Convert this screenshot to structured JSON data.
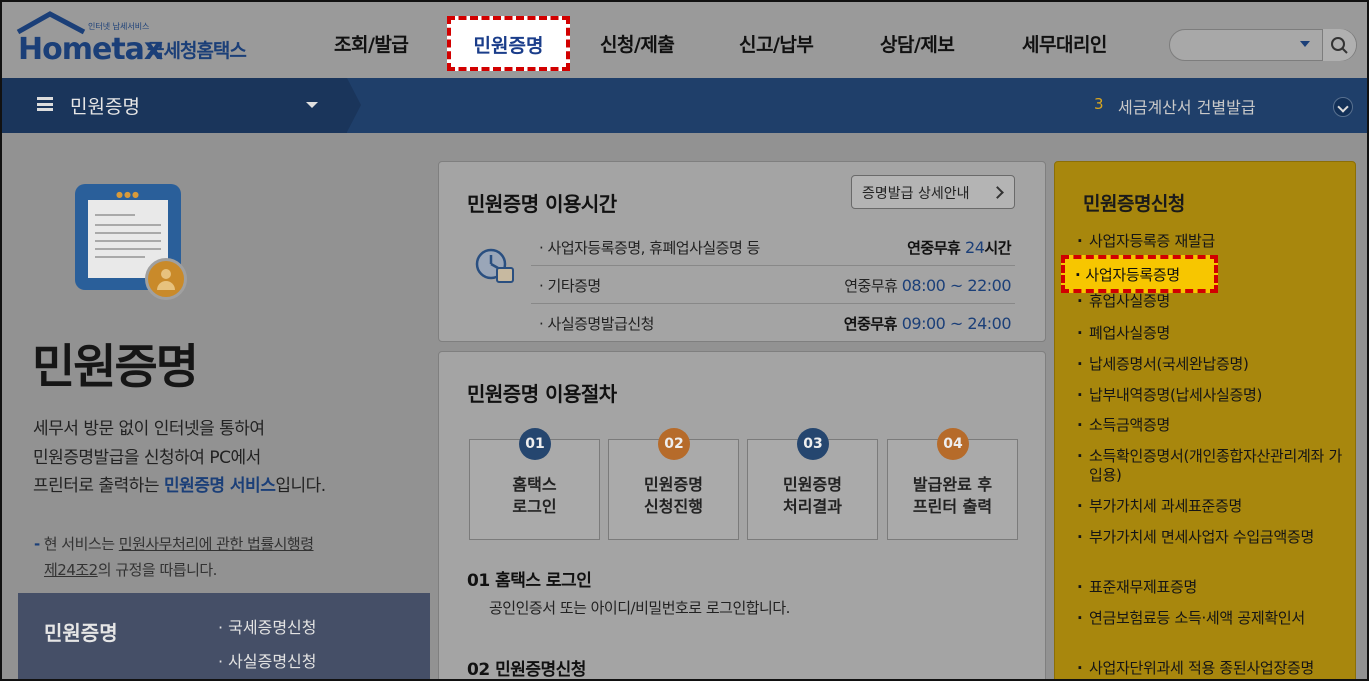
{
  "logo": {
    "brand": "Hometax",
    "subtitle": "국세청홈택스",
    "tagline": "인터넷 납세서비스"
  },
  "nav": {
    "items": [
      "조회/발급",
      "민원증명",
      "신청/제출",
      "신고/납부",
      "상담/제보",
      "세무대리인"
    ],
    "active": "민원증명"
  },
  "search": {
    "placeholder": ""
  },
  "bluebar": {
    "title": "민원증명",
    "ticker_num": "3",
    "ticker_text": "세금계산서 건별발급"
  },
  "hero": {
    "title": "민원증명",
    "desc": [
      "세무서 방문 없이 인터넷을 통하여",
      "민원증명발급을 신청하여 PC에서"
    ],
    "desc3_pre": "프린터로 출력하는 ",
    "desc3_hl": "민원증명 서비스",
    "desc3_post": "입니다.",
    "law1_pre": "현 서비스는 ",
    "law1_link": "민원사무처리에 관한 법률시행령",
    "law2_link": "제24조2",
    "law2_post": "의 규정을 따릅니다."
  },
  "cert_box": {
    "title": "민원증명",
    "links": [
      "· 국세증명신청",
      "· 사실증명신청"
    ]
  },
  "hours": {
    "title": "민원증명 이용시간",
    "guide_button": "증명발급 상세안내",
    "rows": [
      {
        "label": "· 사업자등록증명, 휴폐업사실증명 등",
        "prefix": "연중무휴 ",
        "num": "24",
        "suffix": "시간"
      },
      {
        "label": "· 기타증명",
        "prefix": "연중무휴 ",
        "time": "08:00 ~ 22:00"
      },
      {
        "label": "· 사실증명발급신청",
        "prefix": "연중무휴 ",
        "time": "09:00 ~ 24:00"
      }
    ]
  },
  "procedure": {
    "title": "민원증명 이용절차",
    "steps": [
      {
        "num": "01",
        "text": "홈택스\n로그인",
        "color": "blue"
      },
      {
        "num": "02",
        "text": "민원증명\n신청진행",
        "color": "orange"
      },
      {
        "num": "03",
        "text": "민원증명\n처리결과",
        "color": "blue"
      },
      {
        "num": "04",
        "text": "발급완료 후\n프린터 출력",
        "color": "orange"
      }
    ],
    "sub1_title": "01 홈택스 로그인",
    "sub1_desc": "공인인증서 또는 아이디/비밀번호로 로그인합니다.",
    "sub2_title": "02 민원증명신청"
  },
  "right_panel": {
    "title": "민원증명신청",
    "items": [
      "사업자등록증 재발급",
      "사업자등록증명",
      "휴업사실증명",
      "폐업사실증명",
      "납세증명서(국세완납증명)",
      "납부내역증명(납세사실증명)",
      "소득금액증명",
      "소득확인증명서(개인종합자산관리계좌 가입용)",
      "부가가치세 과세표준증명",
      "부가가치세 면세사업자 수입금액증명",
      "표준재무제표증명",
      "연금보험료등 소득·세액 공제확인서",
      "사업자단위과세 적용 종된사업장증명"
    ],
    "highlighted": "사업자등록증명"
  },
  "colors": {
    "accent_blue": "#1b3f78",
    "highlight_red": "#d20000",
    "gold_panel": "#a8870d",
    "step_orange": "#b66b2a"
  }
}
